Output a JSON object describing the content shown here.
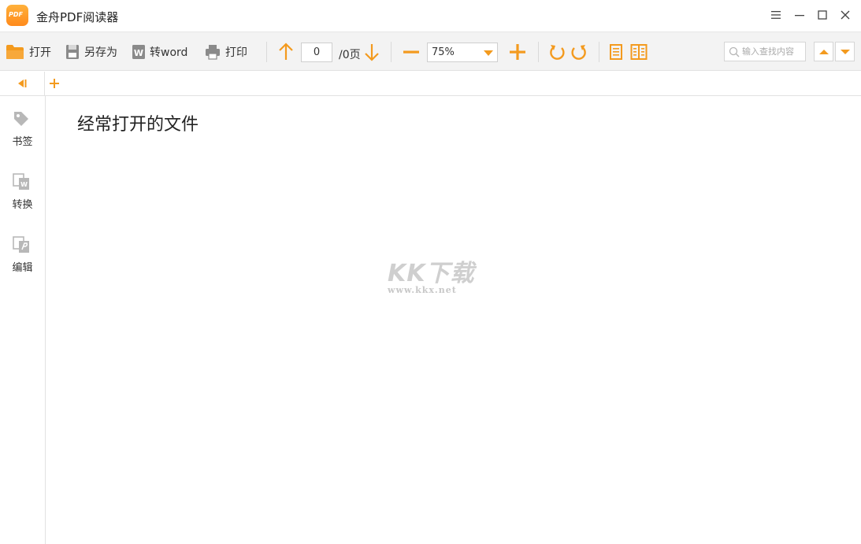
{
  "window": {
    "title": "金舟PDF阅读器",
    "logo_text": "PDF",
    "controls": [
      "menu-icon",
      "minimize-icon",
      "maximize-icon",
      "close-icon"
    ]
  },
  "toolbar": {
    "open_label": "打开",
    "save_as_label": "另存为",
    "to_word_label": "转word",
    "print_label": "打印",
    "page_current": "0",
    "page_total": "/0页",
    "zoom_value": "75%",
    "search_placeholder": "输入查找内容",
    "word_badge": "W"
  },
  "sidebar": {
    "items": [
      {
        "label": "书签",
        "icon": "tag-icon"
      },
      {
        "label": "转换",
        "icon": "convert-icon"
      },
      {
        "label": "编辑",
        "icon": "edit-icon"
      }
    ]
  },
  "main": {
    "section_title": "经常打开的文件"
  },
  "watermark": {
    "text": "KK下载",
    "url": "www.kkx.net"
  },
  "colors": {
    "accent": "#f39a1e",
    "toolbar_bg": "#f3f3f3",
    "border": "#e2e2e2"
  }
}
